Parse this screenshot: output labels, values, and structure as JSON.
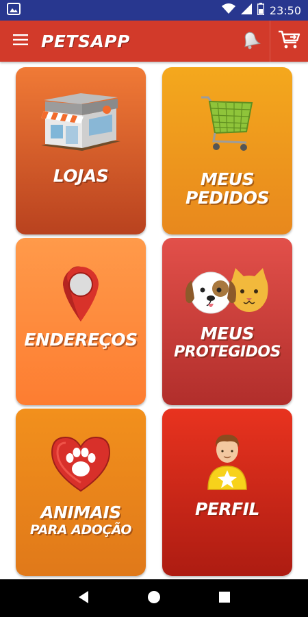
{
  "status_bar": {
    "time": "23:50",
    "icons": [
      "gallery-icon",
      "wifi-icon",
      "signal-icon",
      "battery-icon"
    ]
  },
  "app_bar": {
    "title": "PETSAPP",
    "icons": [
      "menu-icon",
      "bell-icon",
      "cart-icon"
    ],
    "color": "#d23a2a"
  },
  "tiles": [
    {
      "label_line1": "LOJAS",
      "label_line2": "",
      "icon": "store-icon",
      "color": "#f07a36"
    },
    {
      "label_line1": "MEUS",
      "label_line2": "PEDIDOS",
      "icon": "shopping-cart-icon",
      "color": "#f4a81d"
    },
    {
      "label_line1": "ENDEREÇOS",
      "label_line2": "",
      "icon": "map-pin-icon",
      "color": "#ff9a4a"
    },
    {
      "label_line1": "MEUS",
      "label_line2": "PROTEGIDOS",
      "icon": "dog-cat-icon",
      "color": "#e2504a"
    },
    {
      "label_line1": "ANIMAIS",
      "label_line2": "PARA ADOÇÃO",
      "icon": "paw-heart-icon",
      "color": "#f2901c"
    },
    {
      "label_line1": "PERFIL",
      "label_line2": "",
      "icon": "user-star-icon",
      "color": "#e8331f"
    }
  ],
  "nav_bar": {
    "icons": [
      "back-icon",
      "home-icon",
      "recents-icon"
    ]
  }
}
